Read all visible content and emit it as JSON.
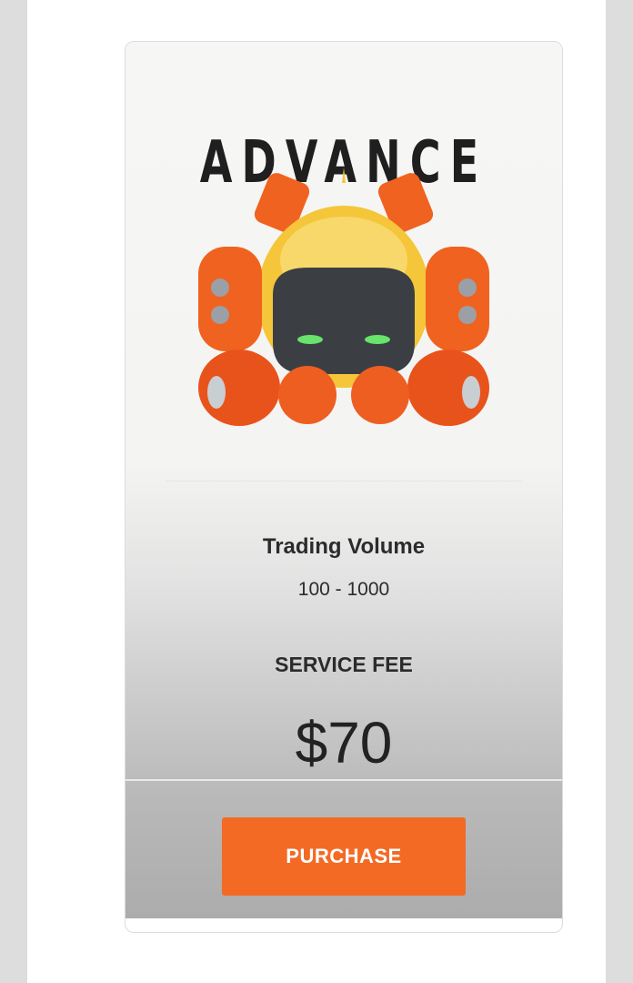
{
  "plan": {
    "title": "ADVANCE",
    "trading_volume_label": "Trading Volume",
    "trading_volume_value": "100 - 1000",
    "service_fee_label": "SERVICE FEE",
    "price": "$70",
    "purchase_label": "PURCHASE"
  },
  "colors": {
    "accent": "#f36a25",
    "robot_orange": "#f0621f",
    "robot_yellow": "#f5c53a",
    "robot_visor": "#3b3f44",
    "robot_eyes": "#68e36b"
  },
  "icons": {
    "robot": "robot-mascot-icon"
  }
}
